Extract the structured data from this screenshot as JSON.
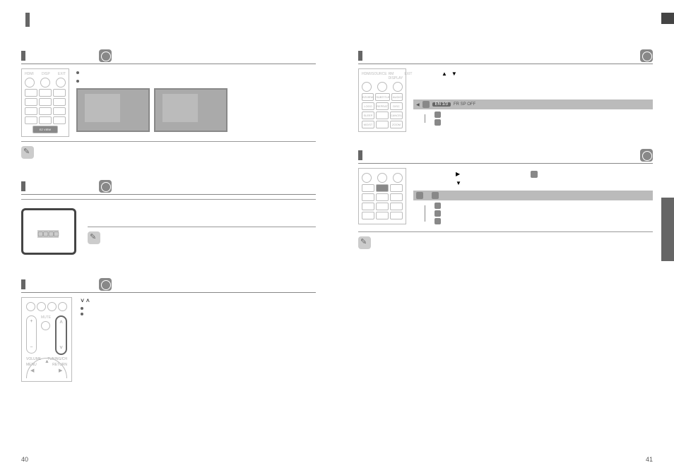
{
  "left": {
    "sections": [
      {
        "id": "ezview",
        "title": "",
        "bullets": [
          "",
          ""
        ]
      },
      {
        "id": "zoom",
        "title": "",
        "note": ""
      },
      {
        "id": "tuning",
        "title": "",
        "bullets": [
          "",
          ""
        ]
      }
    ],
    "remote_ezview_label": "EZ VIEW",
    "tuning_label": "TUNING/CH",
    "volume_label": "VOLUME",
    "menu_label": "MENU",
    "return_label": "RETURN",
    "tv_placeholder": "▢▢▢▢",
    "tuning_icons": "˅ ˄"
  },
  "right": {
    "sections": [
      {
        "id": "audio",
        "title": "",
        "nav": "▲ ▼",
        "osd_sel": "EN 1/3",
        "osd_rest": "FR    SP    OFF"
      },
      {
        "id": "subtitle",
        "title": "",
        "nav1": "▶",
        "nav2": "▼"
      }
    ],
    "remote_top_labels": [
      "HDMI/SOURCE",
      "RM DISPLAY",
      "EXIT"
    ],
    "remote_row1": [
      "EZVIEW",
      "SUBTITLE",
      "AUDIO"
    ],
    "remote_row2": [
      "LOGO",
      "REPEAT",
      "DISC MENU"
    ],
    "remote_row3": [
      "SLEEP",
      "",
      "CANCEL"
    ],
    "remote_row4": [
      "MO/ST",
      "",
      "ZOOM"
    ],
    "osd_list": [
      "",
      "",
      ""
    ],
    "pageno_left": "40",
    "pageno_right": "41"
  }
}
